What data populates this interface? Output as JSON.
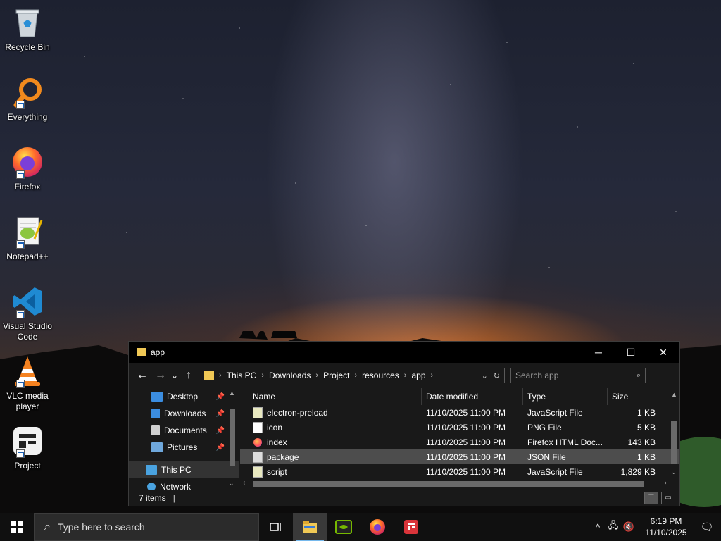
{
  "desktop": {
    "icons": [
      {
        "label": "Recycle Bin",
        "icon": "recycle-bin-icon"
      },
      {
        "label": "Everything",
        "icon": "everything-icon"
      },
      {
        "label": "Firefox",
        "icon": "firefox-icon"
      },
      {
        "label": "Notepad++",
        "icon": "notepad-plus-plus-icon"
      },
      {
        "label": "Visual Studio Code",
        "icon": "vscode-icon"
      },
      {
        "label": "VLC media player",
        "icon": "vlc-icon"
      },
      {
        "label": "Project",
        "icon": "project-icon"
      }
    ]
  },
  "explorer": {
    "title": "app",
    "controls": {
      "minimize": "─",
      "maximize": "☐",
      "close": "✕"
    },
    "nav": {
      "back": "←",
      "forward": "→",
      "recent": "⌄",
      "up": "↑"
    },
    "breadcrumb": [
      "This PC",
      "Downloads",
      "Project",
      "resources",
      "app"
    ],
    "search": {
      "placeholder": "Search app"
    },
    "nav_pane": [
      {
        "label": "Desktop",
        "pinned": true,
        "color": "#3b8de0"
      },
      {
        "label": "Downloads",
        "pinned": true,
        "color": "#3b8de0"
      },
      {
        "label": "Documents",
        "pinned": true,
        "color": "#d0d0d0"
      },
      {
        "label": "Pictures",
        "pinned": true,
        "color": "#6fa8dc"
      },
      {
        "label": "This PC",
        "pinned": false,
        "color": "#4aa3e0"
      },
      {
        "label": "Network",
        "pinned": false,
        "color": "#4aa3e0"
      }
    ],
    "columns": {
      "name": "Name",
      "date": "Date modified",
      "type": "Type",
      "size": "Size"
    },
    "files": [
      {
        "name": "electron-preload",
        "date": "11/10/2025 11:00 PM",
        "type": "JavaScript File",
        "size": "1 KB",
        "kind": "js",
        "selected": false
      },
      {
        "name": "icon",
        "date": "11/10/2025 11:00 PM",
        "type": "PNG File",
        "size": "5 KB",
        "kind": "png",
        "selected": false
      },
      {
        "name": "index",
        "date": "11/10/2025 11:00 PM",
        "type": "Firefox HTML Doc...",
        "size": "143 KB",
        "kind": "html",
        "selected": false
      },
      {
        "name": "package",
        "date": "11/10/2025 11:00 PM",
        "type": "JSON File",
        "size": "1 KB",
        "kind": "json",
        "selected": true
      },
      {
        "name": "script",
        "date": "11/10/2025 11:00 PM",
        "type": "JavaScript File",
        "size": "1,829 KB",
        "kind": "js",
        "selected": false
      }
    ],
    "status": {
      "items": "7 items",
      "cursor": "|"
    }
  },
  "taskbar": {
    "search_placeholder": "Type here to search",
    "apps": [
      {
        "name": "task-view",
        "active": false
      },
      {
        "name": "file-explorer",
        "active": true
      },
      {
        "name": "nvidia",
        "active": false
      },
      {
        "name": "firefox",
        "active": false
      },
      {
        "name": "project",
        "active": false
      }
    ],
    "tray": {
      "chevron": "^",
      "network": "🖧",
      "volume": "🔇"
    },
    "clock": {
      "time": "6:19 PM",
      "date": "11/10/2025"
    },
    "notification": "🗨"
  },
  "colors": {
    "accent": "#76b9ed",
    "folder": "#f0c855",
    "selection": "#4d4d4d"
  }
}
